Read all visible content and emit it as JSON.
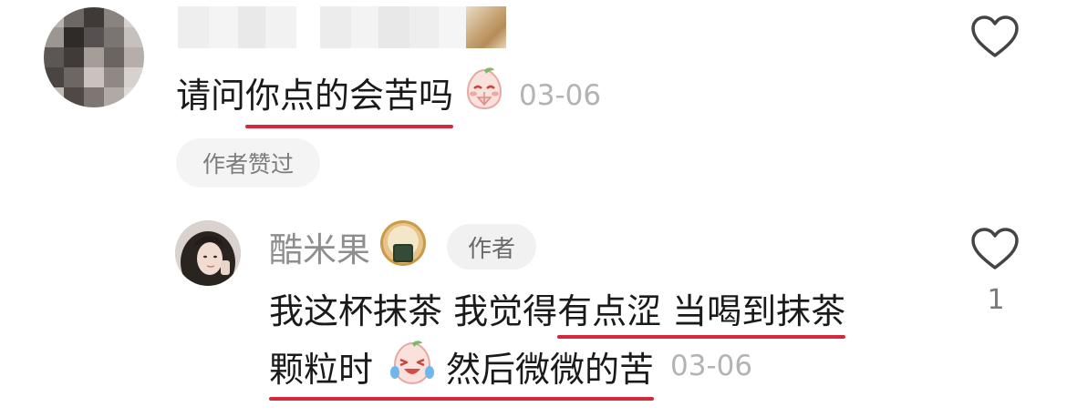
{
  "comment": {
    "text_a": "请问",
    "text_b": "你点的会苦吗",
    "date": "03-06",
    "liked_tag": "作者赞过"
  },
  "reply": {
    "user_name": "酷米果",
    "author_tag": "作者",
    "line1_a": "我这杯抹茶 我觉得",
    "line1_b": "有点涩 当喝到抹茶",
    "line2_a": "颗粒时",
    "line2_b": "然后微微的苦",
    "date": "03-06",
    "like_count": "1"
  },
  "icons": {
    "like": "heart-outline-icon",
    "emoji_pray": "praying-peach-emoji",
    "emoji_laugh_cry": "laughing-crying-peach-emoji",
    "badge": "onigiri-badge-icon"
  },
  "colors": {
    "underline": "#d6283b",
    "meta_text": "#b3b3b3"
  }
}
